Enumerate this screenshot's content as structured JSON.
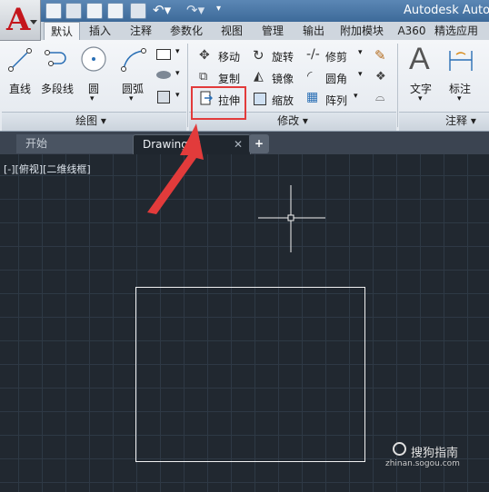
{
  "title_bar": {
    "app_title": "Autodesk AutoCA"
  },
  "ribbon_tabs": [
    "默认",
    "插入",
    "注释",
    "参数化",
    "视图",
    "管理",
    "输出",
    "附加模块",
    "A360",
    "精选应用"
  ],
  "draw_panel": {
    "tools": [
      "直线",
      "多段线",
      "圆",
      "圆弧"
    ],
    "title": "绘图"
  },
  "modify_panel": {
    "row1": [
      "移动",
      "旋转",
      "修剪"
    ],
    "row2": [
      "复制",
      "镜像",
      "圆角"
    ],
    "row3": [
      "拉伸",
      "缩放",
      "阵列"
    ],
    "title": "修改"
  },
  "annotation_panel": {
    "tools": [
      "文字",
      "标注"
    ],
    "title": "注释"
  },
  "file_tabs": {
    "start": "开始",
    "drawing": "Drawing1*",
    "add": "+"
  },
  "viewport_label": "[-][俯视][二维线框]",
  "watermark": {
    "main": "搜狗指南",
    "sub": "zhinan.sogou.com"
  },
  "colors": {
    "highlight": "#e23b3b",
    "arrow": "#e23b3b",
    "canvas": "#212830",
    "title_bar": "#3d6a99"
  },
  "icons": [
    "autocad-logo-icon",
    "new-icon",
    "open-icon",
    "save-icon",
    "saveas-icon",
    "print-icon",
    "undo-icon",
    "redo-icon",
    "line-icon",
    "polyline-icon",
    "circle-icon",
    "arc-icon",
    "move-icon",
    "rotate-icon",
    "trim-icon",
    "copy-icon",
    "mirror-icon",
    "fillet-icon",
    "stretch-icon",
    "scale-icon",
    "array-icon",
    "text-icon",
    "dimension-icon",
    "crosshair-cursor-icon"
  ]
}
